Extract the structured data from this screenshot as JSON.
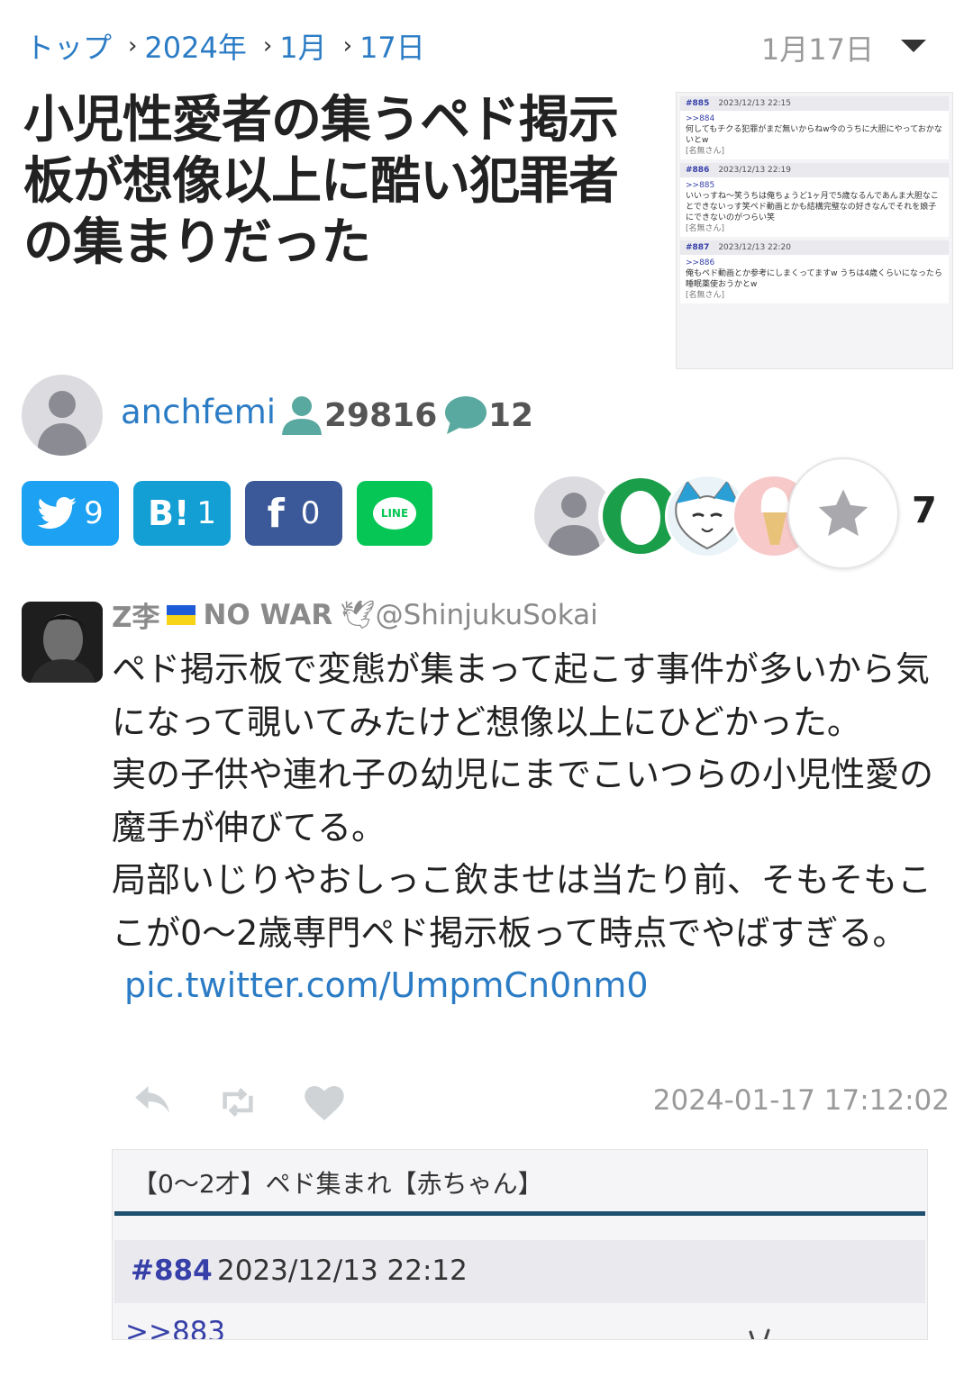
{
  "breadcrumb": [
    "トップ",
    "2024年",
    "1月",
    "17日"
  ],
  "header_date": "1月17日",
  "title": "小児性愛者の集うペド掲示板が想像以上に酷い犯罪者の集まりだった",
  "thumbnail": {
    "posts": [
      {
        "num": "#885",
        "date": "2023/12/13 22:15",
        "ref": ">>884",
        "text": "何してもチクる犯罪がまだ無いからねw今のうちに大胆にやっておかないとw",
        "name": "[名無さん]"
      },
      {
        "num": "#886",
        "date": "2023/12/13 22:19",
        "ref": ">>885",
        "text": "いいっすね〜笑うちは俺ちょうど1ヶ月で5歳なるんであんま大胆なことできないっす笑ペド動画とかも結構完璧なの好きなんでそれを娘子にできないのがつらい笑",
        "name": "[名無さん]"
      },
      {
        "num": "#887",
        "date": "2023/12/13 22:20",
        "ref": ">>886",
        "text": "俺もペド動画とか参考にしまくってますw うちは4歳くらいになったら睡眠薬使おうかとw",
        "name": "[名無さん]"
      }
    ]
  },
  "author": {
    "name": "anchfemi",
    "followers": "29816",
    "comments": "12"
  },
  "share": {
    "twitter": "9",
    "hatena_label": "B!",
    "hatena": "1",
    "facebook_label": "f",
    "facebook": "0",
    "line_label": "LINE"
  },
  "reactions": {
    "count": "7"
  },
  "tweet": {
    "name": "Z李",
    "slogan": "NO WAR",
    "handle": "@ShinjukuSokai",
    "lines": [
      "ペド掲示板で変態が集まって起こす事件が多いから気になって覗いてみたけど想像以上にひどかった。",
      "実の子供や連れ子の幼児にまでこいつらの小児性愛の魔手が伸びてる。",
      "局部いじりやおしっこ飲ませは当たり前、そもそもここが0〜2歳専門ペド掲示板って時点でやばすぎる。"
    ],
    "link": "pic.twitter.com/UmpmCn0nm0",
    "timestamp": "2024-01-17 17:12:02"
  },
  "embed": {
    "board_title": "【0〜2才】ペド集まれ【赤ちゃん】",
    "post_num": "#884",
    "post_date": "2023/12/13 22:12",
    "post_ref": ">>883"
  },
  "colors": {
    "link": "#2b7cc5",
    "twitter": "#1da1f2",
    "hatena": "#139fd4",
    "facebook": "#3b5998",
    "line": "#06c755",
    "stat": "#5aa9a0"
  }
}
